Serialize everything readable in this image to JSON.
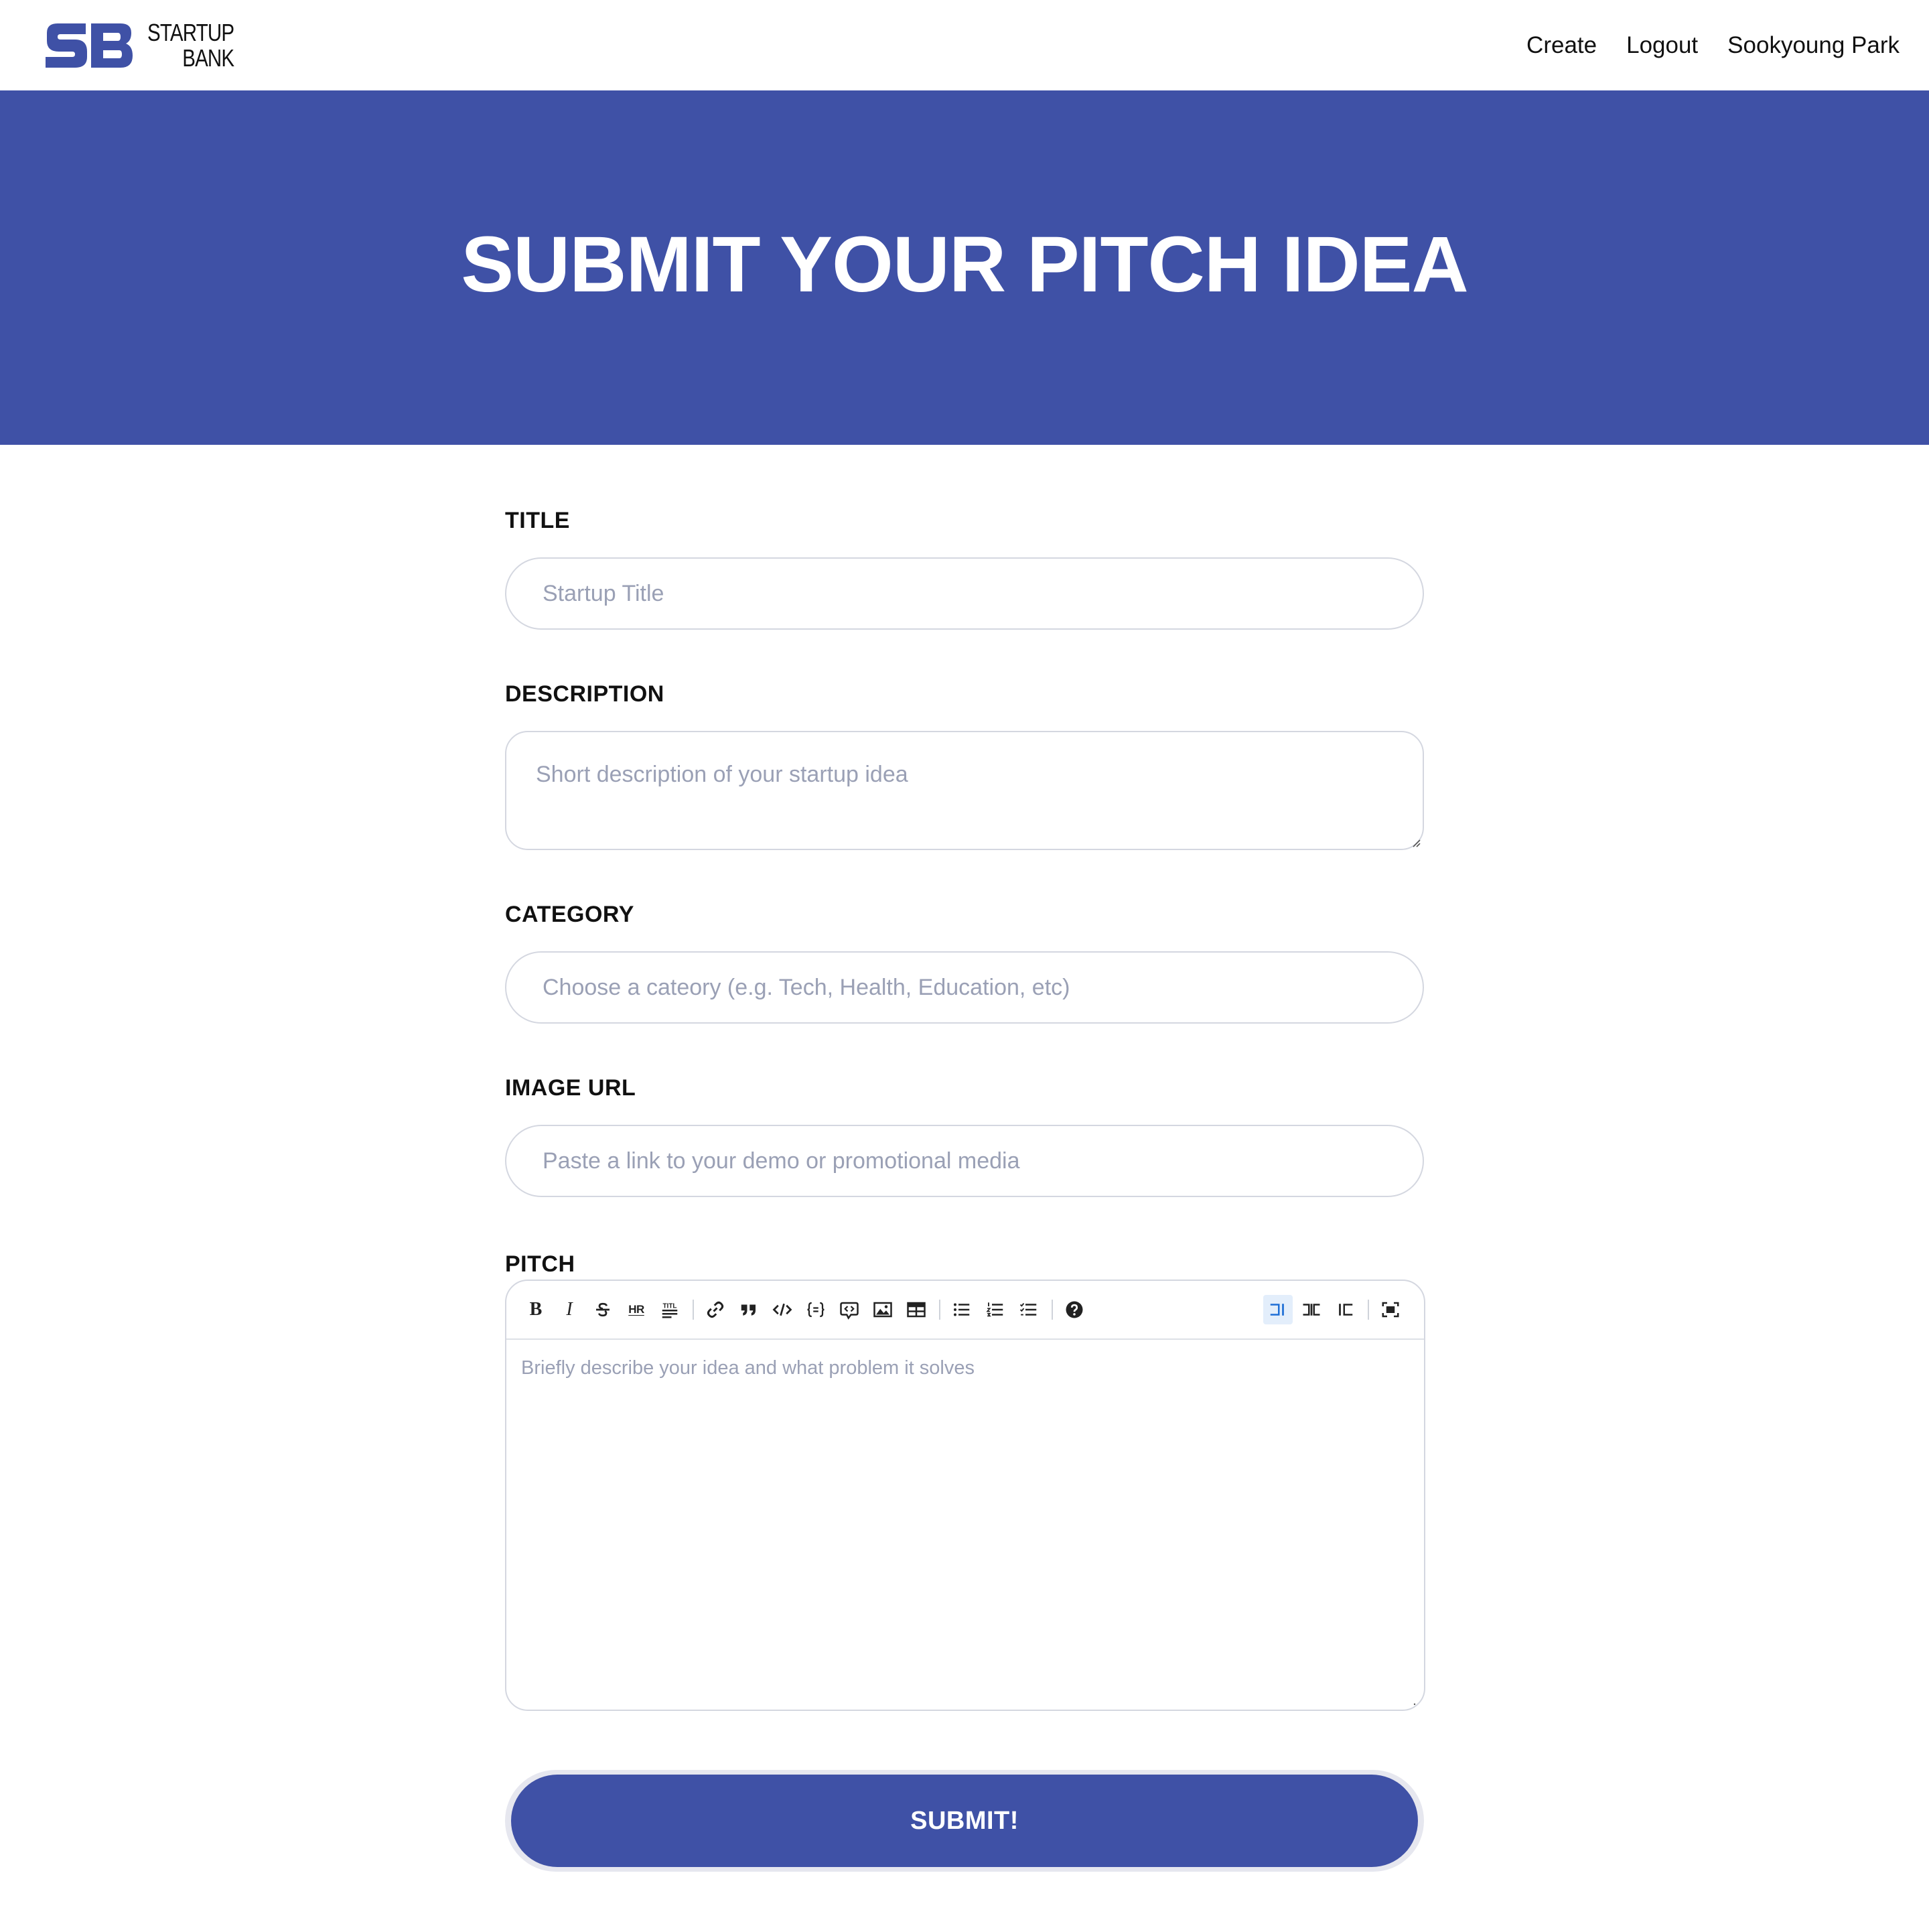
{
  "brand": {
    "mark": "SB",
    "line1": "STARTUP",
    "line2": "BANK",
    "color": "#3f51a6"
  },
  "nav": {
    "create": "Create",
    "logout": "Logout",
    "user": "Sookyoung Park"
  },
  "hero": {
    "title": "SUBMIT YOUR PITCH IDEA",
    "background": "#3f51a6"
  },
  "form": {
    "title": {
      "label": "TITLE",
      "placeholder": "Startup Title",
      "value": ""
    },
    "description": {
      "label": "DESCRIPTION",
      "placeholder": "Short description of your startup idea",
      "value": ""
    },
    "category": {
      "label": "CATEGORY",
      "placeholder": "Choose a cateory (e.g. Tech, Health, Education, etc)",
      "value": ""
    },
    "image_url": {
      "label": "IMAGE URL",
      "placeholder": "Paste a link to your demo or promotional media",
      "value": ""
    },
    "pitch": {
      "label": "PITCH",
      "placeholder": "Briefly describe your idea and what problem it solves",
      "toolbar": {
        "bold": "B",
        "italic": "I",
        "hr": "HR",
        "title": "TITL",
        "icons": [
          "bold-icon",
          "italic-icon",
          "strikethrough-icon",
          "hr-icon",
          "title-icon",
          "link-icon",
          "quote-icon",
          "code-icon",
          "code-block-icon",
          "comment-icon",
          "image-icon",
          "table-icon",
          "unordered-list-icon",
          "ordered-list-icon",
          "checked-list-icon",
          "help-icon",
          "edit-mode-icon",
          "live-mode-icon",
          "preview-mode-icon",
          "fullscreen-icon"
        ]
      }
    },
    "submit": "SUBMIT!"
  }
}
